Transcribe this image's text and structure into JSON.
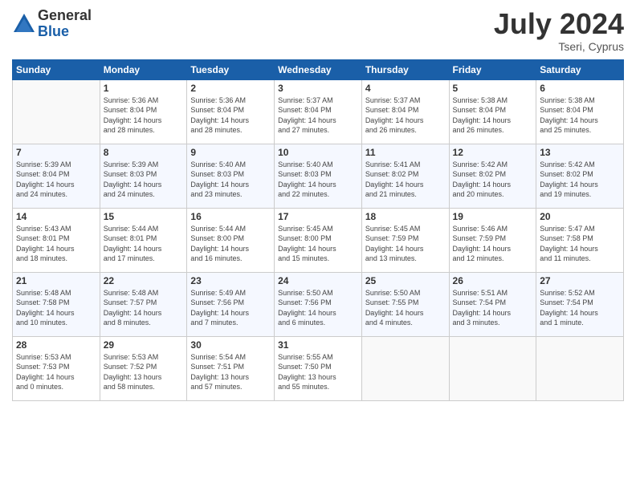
{
  "logo": {
    "general": "General",
    "blue": "Blue"
  },
  "title": {
    "month_year": "July 2024",
    "location": "Tseri, Cyprus"
  },
  "weekdays": [
    "Sunday",
    "Monday",
    "Tuesday",
    "Wednesday",
    "Thursday",
    "Friday",
    "Saturday"
  ],
  "weeks": [
    [
      {
        "day": "",
        "info": ""
      },
      {
        "day": "1",
        "info": "Sunrise: 5:36 AM\nSunset: 8:04 PM\nDaylight: 14 hours\nand 28 minutes."
      },
      {
        "day": "2",
        "info": "Sunrise: 5:36 AM\nSunset: 8:04 PM\nDaylight: 14 hours\nand 28 minutes."
      },
      {
        "day": "3",
        "info": "Sunrise: 5:37 AM\nSunset: 8:04 PM\nDaylight: 14 hours\nand 27 minutes."
      },
      {
        "day": "4",
        "info": "Sunrise: 5:37 AM\nSunset: 8:04 PM\nDaylight: 14 hours\nand 26 minutes."
      },
      {
        "day": "5",
        "info": "Sunrise: 5:38 AM\nSunset: 8:04 PM\nDaylight: 14 hours\nand 26 minutes."
      },
      {
        "day": "6",
        "info": "Sunrise: 5:38 AM\nSunset: 8:04 PM\nDaylight: 14 hours\nand 25 minutes."
      }
    ],
    [
      {
        "day": "7",
        "info": "Sunrise: 5:39 AM\nSunset: 8:04 PM\nDaylight: 14 hours\nand 24 minutes."
      },
      {
        "day": "8",
        "info": "Sunrise: 5:39 AM\nSunset: 8:03 PM\nDaylight: 14 hours\nand 24 minutes."
      },
      {
        "day": "9",
        "info": "Sunrise: 5:40 AM\nSunset: 8:03 PM\nDaylight: 14 hours\nand 23 minutes."
      },
      {
        "day": "10",
        "info": "Sunrise: 5:40 AM\nSunset: 8:03 PM\nDaylight: 14 hours\nand 22 minutes."
      },
      {
        "day": "11",
        "info": "Sunrise: 5:41 AM\nSunset: 8:02 PM\nDaylight: 14 hours\nand 21 minutes."
      },
      {
        "day": "12",
        "info": "Sunrise: 5:42 AM\nSunset: 8:02 PM\nDaylight: 14 hours\nand 20 minutes."
      },
      {
        "day": "13",
        "info": "Sunrise: 5:42 AM\nSunset: 8:02 PM\nDaylight: 14 hours\nand 19 minutes."
      }
    ],
    [
      {
        "day": "14",
        "info": "Sunrise: 5:43 AM\nSunset: 8:01 PM\nDaylight: 14 hours\nand 18 minutes."
      },
      {
        "day": "15",
        "info": "Sunrise: 5:44 AM\nSunset: 8:01 PM\nDaylight: 14 hours\nand 17 minutes."
      },
      {
        "day": "16",
        "info": "Sunrise: 5:44 AM\nSunset: 8:00 PM\nDaylight: 14 hours\nand 16 minutes."
      },
      {
        "day": "17",
        "info": "Sunrise: 5:45 AM\nSunset: 8:00 PM\nDaylight: 14 hours\nand 15 minutes."
      },
      {
        "day": "18",
        "info": "Sunrise: 5:45 AM\nSunset: 7:59 PM\nDaylight: 14 hours\nand 13 minutes."
      },
      {
        "day": "19",
        "info": "Sunrise: 5:46 AM\nSunset: 7:59 PM\nDaylight: 14 hours\nand 12 minutes."
      },
      {
        "day": "20",
        "info": "Sunrise: 5:47 AM\nSunset: 7:58 PM\nDaylight: 14 hours\nand 11 minutes."
      }
    ],
    [
      {
        "day": "21",
        "info": "Sunrise: 5:48 AM\nSunset: 7:58 PM\nDaylight: 14 hours\nand 10 minutes."
      },
      {
        "day": "22",
        "info": "Sunrise: 5:48 AM\nSunset: 7:57 PM\nDaylight: 14 hours\nand 8 minutes."
      },
      {
        "day": "23",
        "info": "Sunrise: 5:49 AM\nSunset: 7:56 PM\nDaylight: 14 hours\nand 7 minutes."
      },
      {
        "day": "24",
        "info": "Sunrise: 5:50 AM\nSunset: 7:56 PM\nDaylight: 14 hours\nand 6 minutes."
      },
      {
        "day": "25",
        "info": "Sunrise: 5:50 AM\nSunset: 7:55 PM\nDaylight: 14 hours\nand 4 minutes."
      },
      {
        "day": "26",
        "info": "Sunrise: 5:51 AM\nSunset: 7:54 PM\nDaylight: 14 hours\nand 3 minutes."
      },
      {
        "day": "27",
        "info": "Sunrise: 5:52 AM\nSunset: 7:54 PM\nDaylight: 14 hours\nand 1 minute."
      }
    ],
    [
      {
        "day": "28",
        "info": "Sunrise: 5:53 AM\nSunset: 7:53 PM\nDaylight: 14 hours\nand 0 minutes."
      },
      {
        "day": "29",
        "info": "Sunrise: 5:53 AM\nSunset: 7:52 PM\nDaylight: 13 hours\nand 58 minutes."
      },
      {
        "day": "30",
        "info": "Sunrise: 5:54 AM\nSunset: 7:51 PM\nDaylight: 13 hours\nand 57 minutes."
      },
      {
        "day": "31",
        "info": "Sunrise: 5:55 AM\nSunset: 7:50 PM\nDaylight: 13 hours\nand 55 minutes."
      },
      {
        "day": "",
        "info": ""
      },
      {
        "day": "",
        "info": ""
      },
      {
        "day": "",
        "info": ""
      }
    ]
  ]
}
